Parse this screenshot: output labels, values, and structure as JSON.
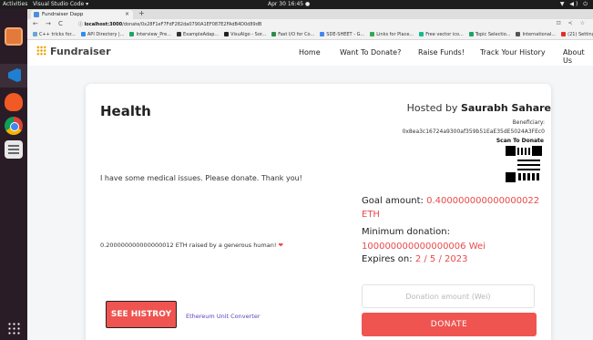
{
  "os": {
    "activities": "Activities",
    "app_name": "Visual Studio Code ▾",
    "clock": "Apr 30 16:45 ●",
    "tray": "▼ ◀) ⏻"
  },
  "browser": {
    "tab_title": "Fundraiser Dapp",
    "tab_close": "×",
    "new_tab": "+",
    "back": "←",
    "forward": "→",
    "reload": "C",
    "url_host": "localhost:3000",
    "url_path": "/donate/0x28F1eF7FdF282da0790A1EF087E2FAdB4D0d89dB",
    "address_icons": "⊡ < ☆",
    "bookmarks": [
      {
        "label": "C++ tricks for...",
        "color": "#6aa6d6"
      },
      {
        "label": "API Directory |...",
        "color": "#2f8ef4"
      },
      {
        "label": "Interview_Pre...",
        "color": "#1fa463"
      },
      {
        "label": "ExampleAdap...",
        "color": "#333333"
      },
      {
        "label": "VisuAlgo - Sor...",
        "color": "#222222"
      },
      {
        "label": "Fast I/O for Co...",
        "color": "#2f8d46"
      },
      {
        "label": "SDE-SHEET - G...",
        "color": "#4285f4"
      },
      {
        "label": "Links for Place...",
        "color": "#34a853"
      },
      {
        "label": "Free vector ico...",
        "color": "#0fbf8f"
      },
      {
        "label": "Topic Selectio...",
        "color": "#1fa463"
      },
      {
        "label": "International...",
        "color": "#555555"
      },
      {
        "label": "(21) Setting u...",
        "color": "#e52d27"
      }
    ]
  },
  "app": {
    "brand": "Fundraiser",
    "nav": [
      "Home",
      "Want To Donate?",
      "Raise Funds!",
      "Track Your History",
      "About Us"
    ]
  },
  "fundraiser": {
    "title": "Health",
    "hosted_by_label": "Hosted by",
    "host_name": "Saurabh Sahare",
    "beneficiary_label": "Beneficiary:",
    "beneficiary_address": "0x8ea3c16724a9300af359b51EaE35dE5024A3FEc0",
    "scan_label": "Scan To Donate",
    "description": "I have some medical issues. Please donate. Thank you!",
    "raised_text": "0.200000000000000012 ETH raised by a generous human!",
    "raised_heart": "❤",
    "goal_label": "Goal amount:",
    "goal_value": "0.400000000000000022 ETH",
    "minimum_label": "Minimum donation:",
    "minimum_value": "100000000000000006 Wei",
    "expires_label": "Expires on:",
    "expires_value": "2 / 5 / 2023",
    "donation_placeholder": "Donation amount (Wei)",
    "donate_label": "DONATE",
    "history_label": "SEE HISTROY",
    "converter_label": "Ethereum Unit Converter"
  }
}
